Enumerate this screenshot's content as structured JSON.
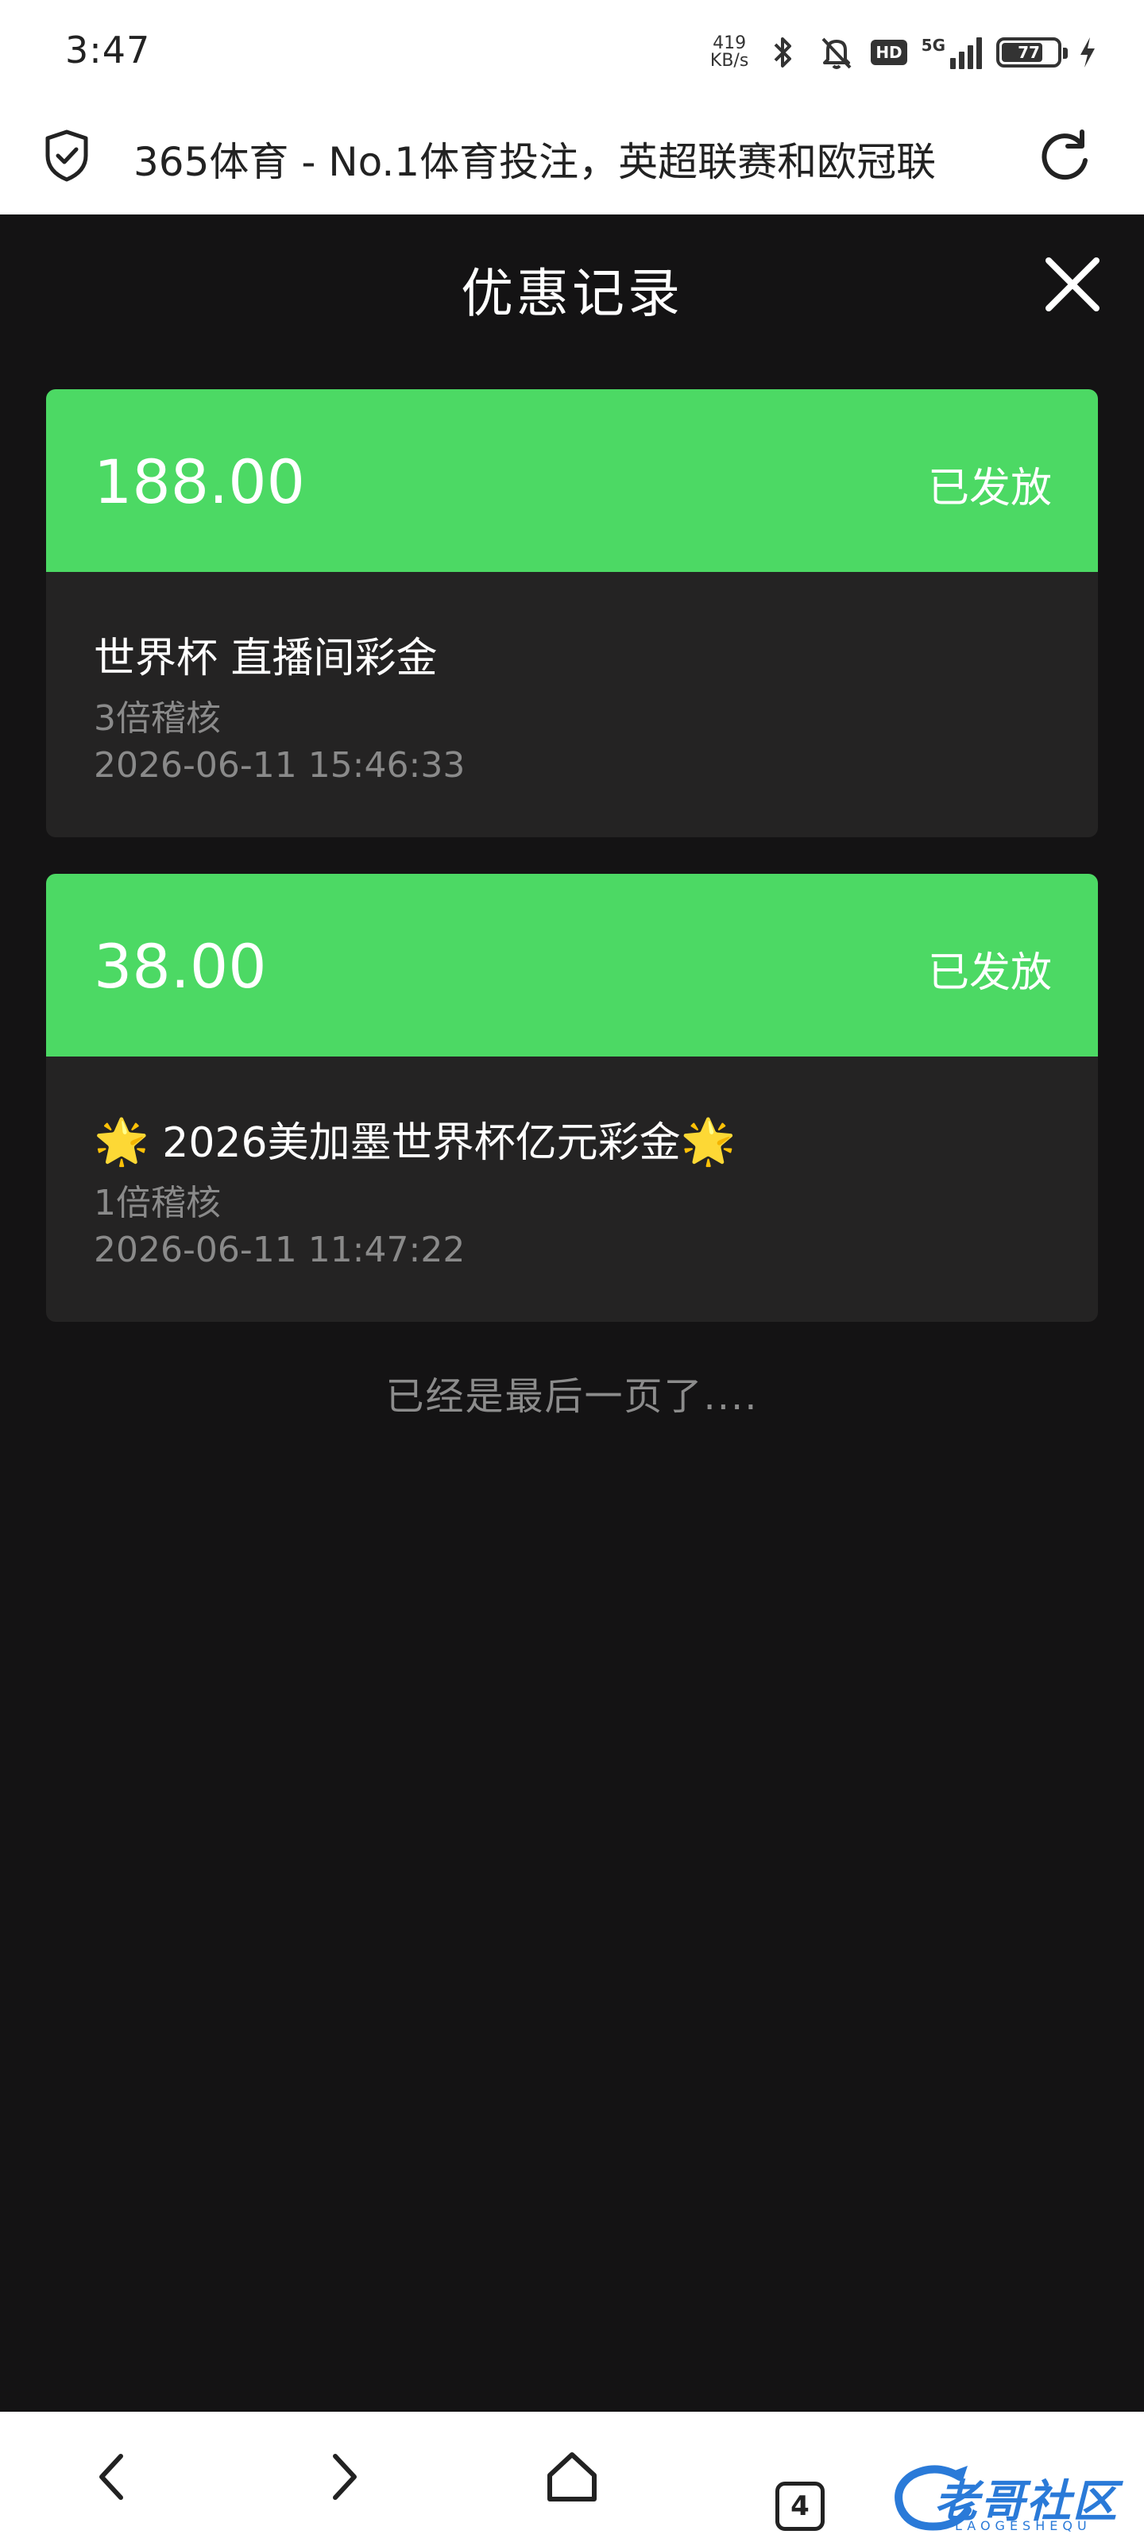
{
  "status_bar": {
    "time": "3:47",
    "net_speed_value": "419",
    "net_speed_unit": "KB/s",
    "hd_label": "HD",
    "network_label": "5G",
    "battery_level": 77,
    "battery_text": "77"
  },
  "url_bar": {
    "title": "365体育 - No.1体育投注，英超联赛和欧冠联"
  },
  "header": {
    "title": "优惠记录"
  },
  "records": [
    {
      "amount": "188.00",
      "status": "已发放",
      "name": "世界杯 直播间彩金",
      "audit": "3倍稽核",
      "time": "2026-06-11 15:46:33"
    },
    {
      "amount": "38.00",
      "status": "已发放",
      "star": "🌟",
      "name": " 2026美加墨世界杯亿元彩金",
      "audit": "1倍稽核",
      "time": "2026-06-11 11:47:22"
    }
  ],
  "footer_text": "已经是最后一页了....",
  "bottom_nav": {
    "tab_count": "4",
    "watermark_text": "老哥社区",
    "watermark_sub": "LAOGESHEQU"
  },
  "colors": {
    "card_header_green": "#4cd964",
    "background": "#141314",
    "card_body": "#242323",
    "secondary_text": "#8a8a8a"
  }
}
